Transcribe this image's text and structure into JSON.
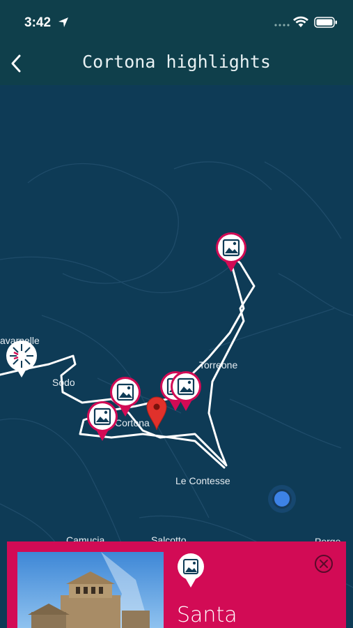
{
  "status": {
    "time": "3:42"
  },
  "nav": {
    "title": "Cortona highlights"
  },
  "map": {
    "places": {
      "tavarnelle": "avarnelle",
      "sodo": "Sodo",
      "cortona": "Cortona",
      "torreone": "Torreone",
      "le_contesse": "Le Contesse",
      "camucia": "Camucia",
      "salcotto": "Salcotto",
      "perge": "Perge"
    }
  },
  "card": {
    "title": "Santa"
  },
  "colors": {
    "accent": "#d20b55",
    "map_bg": "#0e3b56",
    "bar": "#0f3f4b",
    "route": "#ffffff",
    "user": "#3d82e6"
  }
}
